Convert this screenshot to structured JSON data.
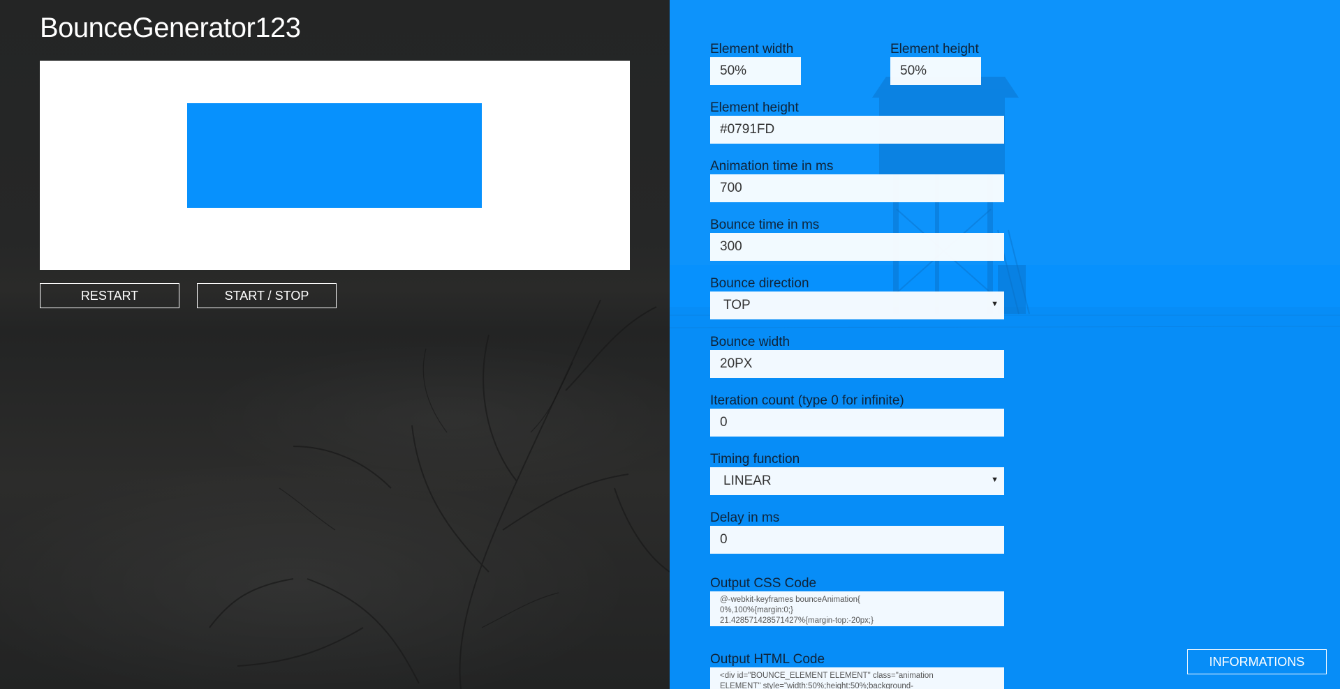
{
  "app": {
    "title": "BounceGenerator123"
  },
  "theme": {
    "accent": "#0791FD",
    "left_bg": "#252626",
    "preview_bg": "#FFFFFF"
  },
  "preview": {
    "element_color": "#0791FD"
  },
  "controls": {
    "restart_label": "RESTART",
    "startstop_label": "START / STOP"
  },
  "form": {
    "element_width": {
      "label": "Element width",
      "value": "50%"
    },
    "element_height": {
      "label": "Element height",
      "value": "50%"
    },
    "element_color": {
      "label": "Element height",
      "value": "#0791FD"
    },
    "animation_time": {
      "label": "Animation time in ms",
      "value": "700"
    },
    "bounce_time": {
      "label": "Bounce time in ms",
      "value": "300"
    },
    "bounce_direction": {
      "label": "Bounce direction",
      "value": "TOP"
    },
    "bounce_width": {
      "label": "Bounce width",
      "value": "20PX"
    },
    "iteration_count": {
      "label": "Iteration count (type 0 for infinite)",
      "value": "0"
    },
    "timing_function": {
      "label": "Timing function",
      "value": "LINEAR"
    },
    "delay": {
      "label": "Delay in ms",
      "value": "0"
    },
    "output_css": {
      "label": "Output CSS Code",
      "value": "@-webkit-keyframes bounceAnimation{\n0%,100%{margin:0;}\n21.428571428571427%{margin-top:-20px;}"
    },
    "output_html": {
      "label": "Output HTML Code",
      "value": "<div id=\"BOUNCE_ELEMENT ELEMENT\" class=\"animation\nELEMENT\" style=\"width:50%;height:50%;background-"
    }
  },
  "info": {
    "label": "INFORMATIONS"
  }
}
